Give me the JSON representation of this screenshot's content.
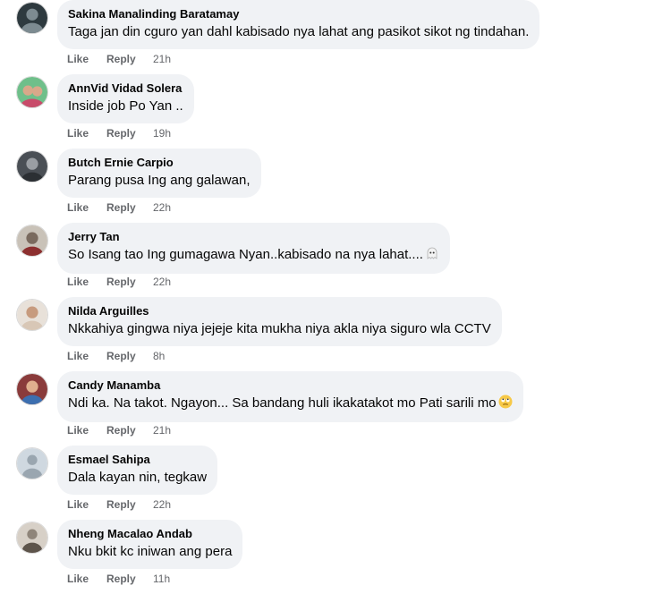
{
  "actions": {
    "like": "Like",
    "reply": "Reply"
  },
  "comments": [
    {
      "author": "Sakina Manalinding Baratamay",
      "text": "Taga jan din cguro yan dahl kabisado nya lahat ang pasikot sikot ng tindahan.",
      "time": "21h",
      "avatar_bg": "#2e3a3f",
      "avatar_fg": "#7d8b91"
    },
    {
      "author": "AnnVid Vidad Solera",
      "text": "Inside job Po Yan ..",
      "time": "19h",
      "avatar_bg": "#6fbf8a",
      "avatar_fg": "#d9a88a"
    },
    {
      "author": "Butch Ernie Carpio",
      "text": "Parang pusa Ing ang galawan,",
      "time": "22h",
      "avatar_bg": "#4a4f55",
      "avatar_fg": "#9a9ea3"
    },
    {
      "author": "Jerry Tan",
      "text": "So Isang tao Ing gumagawa Nyan..kabisado na nya lahat....",
      "emoji": "ghost-emoji",
      "time": "22h",
      "avatar_bg": "#c9c2b8",
      "avatar_fg": "#7a6a5e"
    },
    {
      "author": "Nilda Arguilles",
      "text": "Nkkahiya gingwa niya jejeje kita mukha niya akla niya siguro wla CCTV",
      "time": "8h",
      "avatar_bg": "#e8e1d9",
      "avatar_fg": "#c79b7e"
    },
    {
      "author": "Candy Manamba",
      "text": "Ndi ka. Na takot. Ngayon... Sa bandang huli ikakatakot mo Pati sarili mo",
      "emoji": "eye-roll-emoji",
      "time": "21h",
      "avatar_bg": "#8a3b3b",
      "avatar_fg": "#e0b08f"
    },
    {
      "author": "Esmael Sahipa",
      "text": "Dala kayan nin, tegkaw",
      "time": "22h",
      "avatar_bg": "#cfd8e0",
      "avatar_fg": "#9aa6b0"
    },
    {
      "author": "Nheng Macalao Andab",
      "text": "Nku bkit kc iniwan ang pera",
      "time": "11h",
      "avatar_bg": "#d7d0c7",
      "avatar_fg": "#8f857a"
    }
  ]
}
